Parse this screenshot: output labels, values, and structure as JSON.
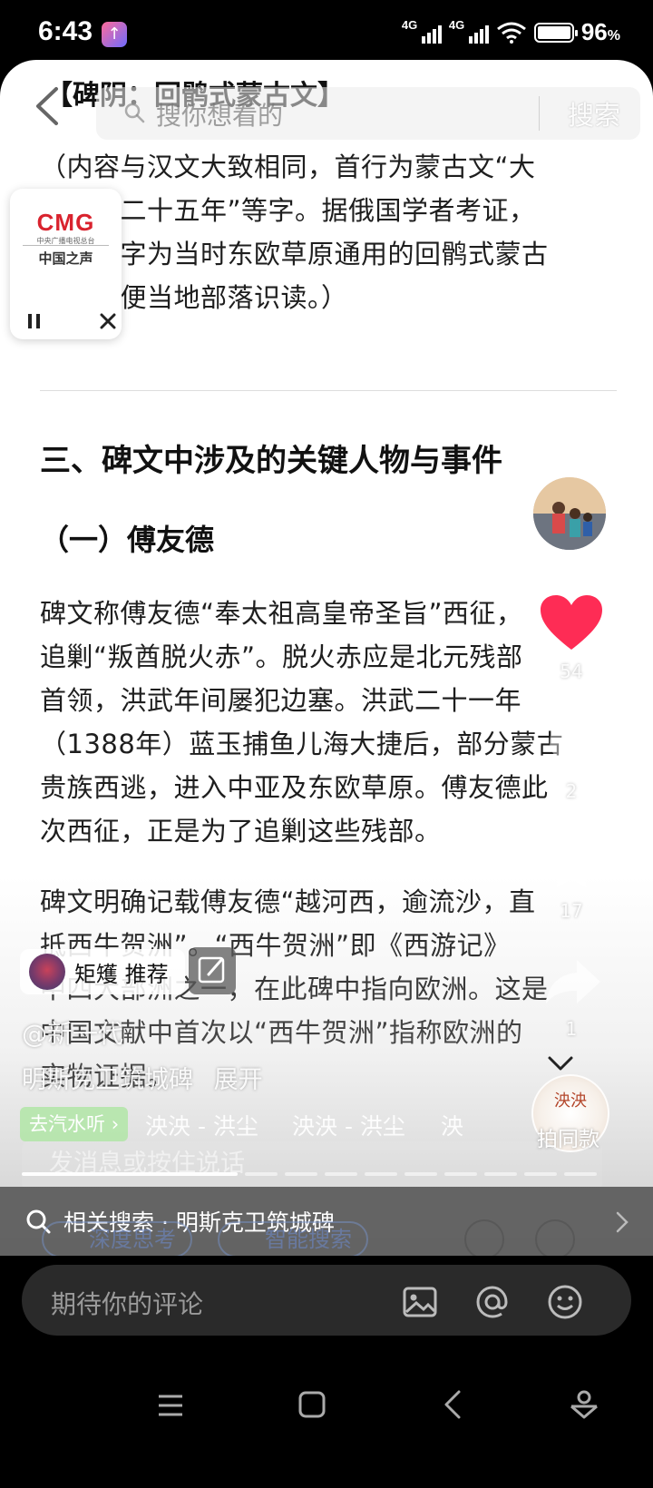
{
  "status_bar": {
    "time": "6:43",
    "network_1": "4G",
    "network_2": "4G",
    "battery": "96",
    "battery_unit": "%"
  },
  "header": {
    "heading_peek": "【碑阴：回鹘式蒙古文】",
    "search_placeholder": "搜你想看的",
    "search_button": "搜索"
  },
  "audio_card": {
    "brand": "CMG",
    "brand_sub": "中央广播电视总台",
    "channel": "中国之声"
  },
  "article": {
    "para1": "（内容与汉文大致相同，首行为蒙古文“大明洪武二十五年”等字。据俄国学者考证，蒙古文字为当时东欧草原通用的回鹘式蒙古文，以便当地部落识读。）",
    "para1_lines": [
      "（内容与汉文大致相同，首行为蒙古文“大",
      "明洪武二十五年”等字。据俄国学者考证，",
      "蒙古文字为当时东欧草原通用的回鹘式蒙古",
      "文，以便当地部落识读。）"
    ],
    "section_title": "三、碑文中涉及的关键人物与事件",
    "sub_title": "（一）傅友德",
    "para2_lines": [
      "碑文称傅友德“奉太祖高皇帝圣旨”西征，",
      "追剿“叛酋脱火赤”。脱火赤应是北元残部",
      "首领，洪武年间屡犯边塞。洪武二十一年",
      "（1388年）蓝玉捕鱼儿海大捷后，部分蒙古",
      "贵族西逃，进入中亚及东欧草原。傅友德此",
      "次西征，正是为了追剿这些残部。"
    ],
    "para3_lines": [
      "碑文明确记载傅友德“越河西，逾流沙，直",
      "抵西牛贺洲”。“西牛贺洲”即《西游记》",
      "中四大部洲之一，在此碑中指向欧洲。这是",
      "中国文献中首次以“西牛贺洲”指称欧洲的",
      "实物证据。"
    ]
  },
  "rail": {
    "like_count": "54",
    "comment_count": "2",
    "favorite_count": "17",
    "share_count": "1"
  },
  "video_overlay": {
    "recommend_label": "矩矱 推荐",
    "author": "@新一代",
    "caption": "明斯克卫筑城碑",
    "expand": "展开",
    "music_tag": "去汽水听",
    "music_track_1": "泱泱 - 洪尘",
    "music_track_2": "泱泱 - 洪尘",
    "music_track_3": "泱",
    "album_text": "泱泱",
    "paitongkuan": "拍同款",
    "message_placeholder": "发消息或按住说话"
  },
  "related": {
    "text": "相关搜索 · 明斯克卫筑城碑",
    "chip_deep": "深度思考",
    "chip_smart": "智能搜索"
  },
  "comment_bar": {
    "placeholder": "期待你的评论"
  },
  "colors": {
    "heart": "#fe2c55",
    "cmg_red": "#d9232e",
    "music_tag": "#b4e6aa"
  }
}
